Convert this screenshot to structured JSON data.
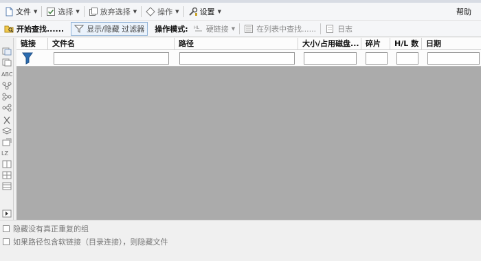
{
  "menubar": {
    "file": "文件",
    "select": "选择",
    "deselect": "放弃选择",
    "operations": "操作",
    "settings": "设置",
    "help": "帮助"
  },
  "toolbar": {
    "start_search": "开始查找......",
    "toggle_filter": "显示/隐藏 过滤器",
    "mode_label": "操作模式:",
    "hard_link": "硬链接",
    "find_in_list": "在列表中查找......",
    "log": "日志"
  },
  "leftbar": {
    "abc_label": "ABC",
    "lz_label": "LZ"
  },
  "grid": {
    "columns": [
      "链接",
      "文件名",
      "路径",
      "大小/占用磁盘...",
      "碎片",
      "H/L 数",
      "日期"
    ]
  },
  "options": {
    "hide_no_duplicates": "隐藏没有真正重复的组",
    "hide_symlinks": "如果路径包含软链接（目录连接），则隐藏文件"
  },
  "colors": {
    "accent": "#2b6cb0",
    "grid_background": "#ababab"
  }
}
